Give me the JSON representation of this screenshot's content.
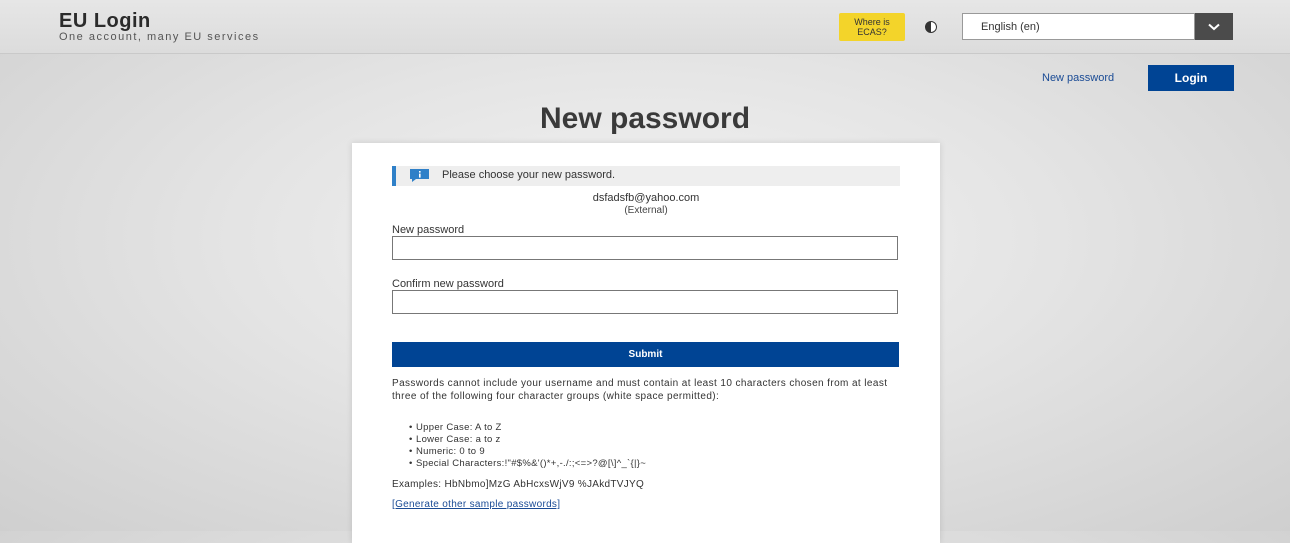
{
  "header": {
    "title": "EU Login",
    "subtitle": "One account, many EU services",
    "ecas_badge": "Where is ECAS?",
    "language_value": "English (en)",
    "contrast_icon": "contrast-icon",
    "language_button_icon": "chevron-down-icon"
  },
  "nav": {
    "new_password_link": "New password",
    "login_button": "Login"
  },
  "page": {
    "title": "New password"
  },
  "form": {
    "info_message": "Please choose your new password.",
    "info_icon": "info-speech-icon",
    "user_email": "dsfadsfb@yahoo.com",
    "user_type": "(External)",
    "new_password_label": "New password",
    "new_password_value": "",
    "confirm_password_label": "Confirm new password",
    "confirm_password_value": "",
    "submit_label": "Submit"
  },
  "rules": {
    "intro": "Passwords cannot include your username and must contain at least 10 characters chosen from at least three of the following four character groups (white space permitted):",
    "items": [
      "Upper Case: A to Z",
      "Lower Case: a to z",
      "Numeric: 0 to 9",
      "Special Characters:!\"#$%&'()*+,-./:;<=>?@[\\]^_`{|}~"
    ],
    "examples": "Examples: HbNbmo]MzG AbHcxsWjV9 %JAkdTVJYQ",
    "generate_link": "[Generate other sample passwords]"
  },
  "colors": {
    "primary": "#004494",
    "link": "#1a4b95",
    "ecas_yellow": "#f3d42a",
    "info_accent": "#2f80c8"
  }
}
